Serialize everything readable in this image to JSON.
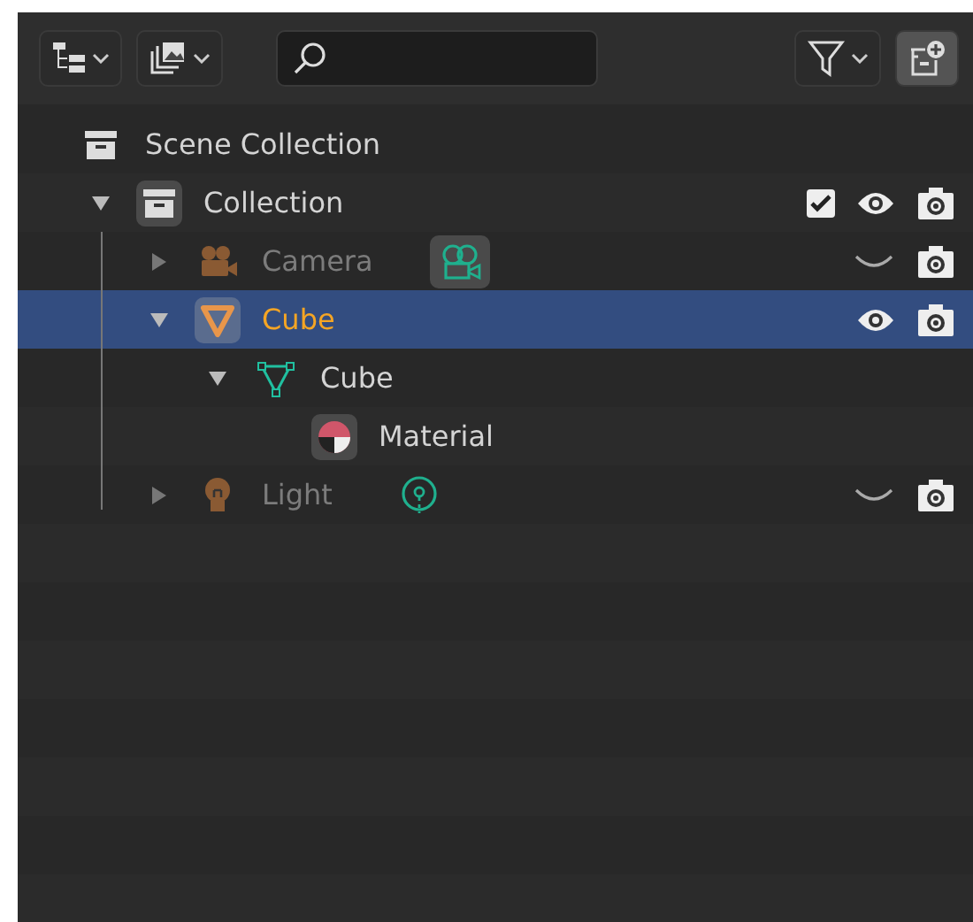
{
  "toolbar": {
    "controls": [
      {
        "kind": "display_mode",
        "dropdown": true
      },
      {
        "kind": "view_layer",
        "dropdown": true
      },
      {
        "kind": "search"
      },
      {
        "kind": "filter",
        "dropdown": true
      },
      {
        "kind": "new_collection",
        "dropdown": false
      }
    ]
  },
  "tree": {
    "name": "Scene Collection",
    "kind": "scene",
    "children": [
      {
        "name": "Collection",
        "kind": "collection",
        "expanded": true,
        "selected": false,
        "checked": true,
        "hidden": false,
        "children": [
          {
            "name": "Camera",
            "kind": "camera",
            "expanded": false,
            "selected": false,
            "hidden": true
          },
          {
            "name": "Cube",
            "kind": "mesh_object",
            "expanded": true,
            "selected": true,
            "hidden": false,
            "children": [
              {
                "name": "Cube",
                "kind": "mesh_data",
                "expanded": true,
                "selected": false,
                "children": [
                  {
                    "name": "Material",
                    "kind": "material",
                    "selected": false
                  }
                ]
              }
            ]
          },
          {
            "name": "Light",
            "kind": "light",
            "expanded": false,
            "selected": false,
            "hidden": true
          }
        ]
      }
    ]
  }
}
